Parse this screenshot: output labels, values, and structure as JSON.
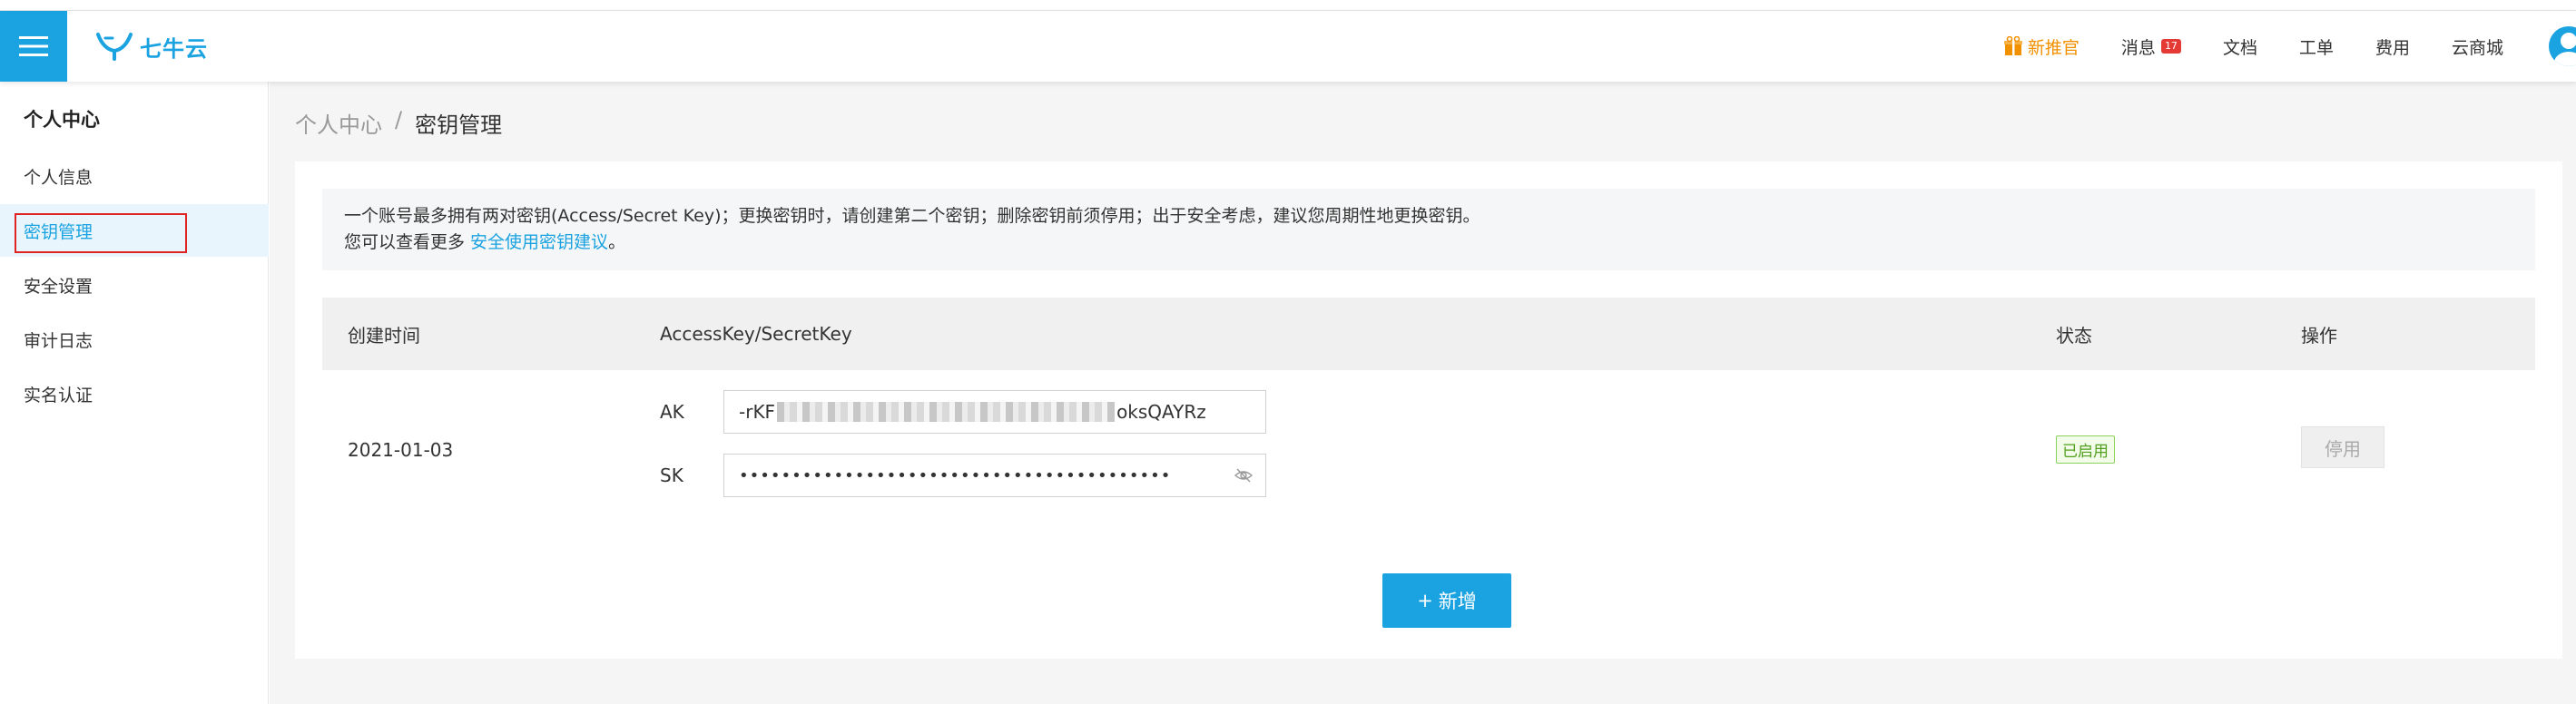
{
  "header": {
    "logo_text": "七牛云",
    "nav": [
      {
        "label": "新推官",
        "icon": "gift-icon",
        "color": "#f29100"
      },
      {
        "label": "消息",
        "badge": "17"
      },
      {
        "label": "文档"
      },
      {
        "label": "工单"
      },
      {
        "label": "费用"
      },
      {
        "label": "云商城"
      }
    ]
  },
  "sidebar": {
    "title": "个人中心",
    "items": [
      {
        "label": "个人信息"
      },
      {
        "label": "密钥管理",
        "active": true
      },
      {
        "label": "安全设置"
      },
      {
        "label": "审计日志"
      },
      {
        "label": "实名认证"
      }
    ]
  },
  "breadcrumb": {
    "parent": "个人中心",
    "separator": "/",
    "current": "密钥管理"
  },
  "notice": {
    "line1": "一个账号最多拥有两对密钥(Access/Secret Key)；更换密钥时，请创建第二个密钥；删除密钥前须停用；出于安全考虑，建议您周期性地更换密钥。",
    "line2_prefix": "您可以查看更多 ",
    "line2_link": "安全使用密钥建议",
    "line2_suffix": "。"
  },
  "table": {
    "headers": {
      "created": "创建时间",
      "keys": "AccessKey/SecretKey",
      "status": "状态",
      "actions": "操作"
    },
    "rows": [
      {
        "created": "2021-01-03",
        "ak_label": "AK",
        "ak_prefix": "-rKF",
        "ak_suffix": "oksQAYRz",
        "sk_label": "SK",
        "sk_masked": "•••••••••••••••••••••••••••••••••••••••••",
        "status": "已启用",
        "action": "停用"
      }
    ]
  },
  "add_button": {
    "icon": "+",
    "label": "新增"
  },
  "colors": {
    "brand": "#1aa3e0",
    "promo": "#f29100",
    "status_green": "#52a01e",
    "highlight_red": "#e02424"
  }
}
